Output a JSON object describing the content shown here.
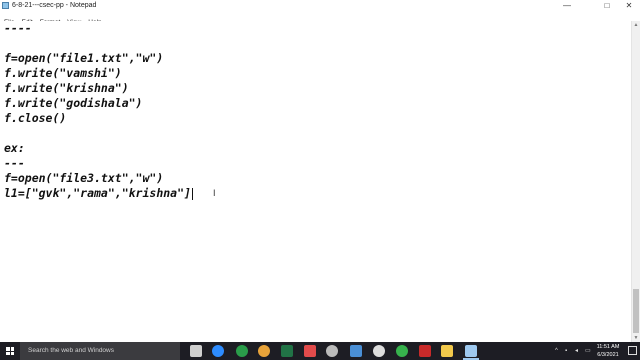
{
  "window": {
    "title": "6-8-21---csec-pp - Notepad",
    "controls": {
      "minimize": "—",
      "maximize": "□",
      "close": "✕"
    }
  },
  "menu": [
    "File",
    "Edit",
    "Format",
    "View",
    "Help"
  ],
  "editor": {
    "lines": [
      "----",
      "",
      "f=open(\"file1.txt\",\"w\")",
      "f.write(\"vamshi\")",
      "f.write(\"krishna\")",
      "f.write(\"godishala\")",
      "f.close()",
      "",
      "ex:",
      "---",
      "f=open(\"file3.txt\",\"w\")",
      "l1=[\"gvk\",\"rama\",\"krishna\"]"
    ]
  },
  "taskbar": {
    "search_placeholder": "Search the web and Windows",
    "tray": {
      "chevron": "^",
      "time": "11:51 AM",
      "date": "6/3/2021"
    },
    "icons": [
      {
        "name": "task-view-icon",
        "color": "#cfcfcf"
      },
      {
        "name": "zoom-icon",
        "color": "#2d8cff"
      },
      {
        "name": "chrome-app-icon",
        "color": "#2a9d4a"
      },
      {
        "name": "chrome-icon",
        "color": "#e8a33a"
      },
      {
        "name": "excel-icon",
        "color": "#217346"
      },
      {
        "name": "snipping-icon",
        "color": "#e24b4b"
      },
      {
        "name": "settings-icon",
        "color": "#bbbbbb"
      },
      {
        "name": "store-icon",
        "color": "#4a8fd6"
      },
      {
        "name": "app-v-icon",
        "color": "#dddddd"
      },
      {
        "name": "app-circle-icon",
        "color": "#37b24d"
      },
      {
        "name": "app-pdf-icon",
        "color": "#c92a2a"
      },
      {
        "name": "file-explorer-icon",
        "color": "#f2c94c"
      },
      {
        "name": "notepad-icon",
        "color": "#9ec9f0"
      }
    ]
  }
}
